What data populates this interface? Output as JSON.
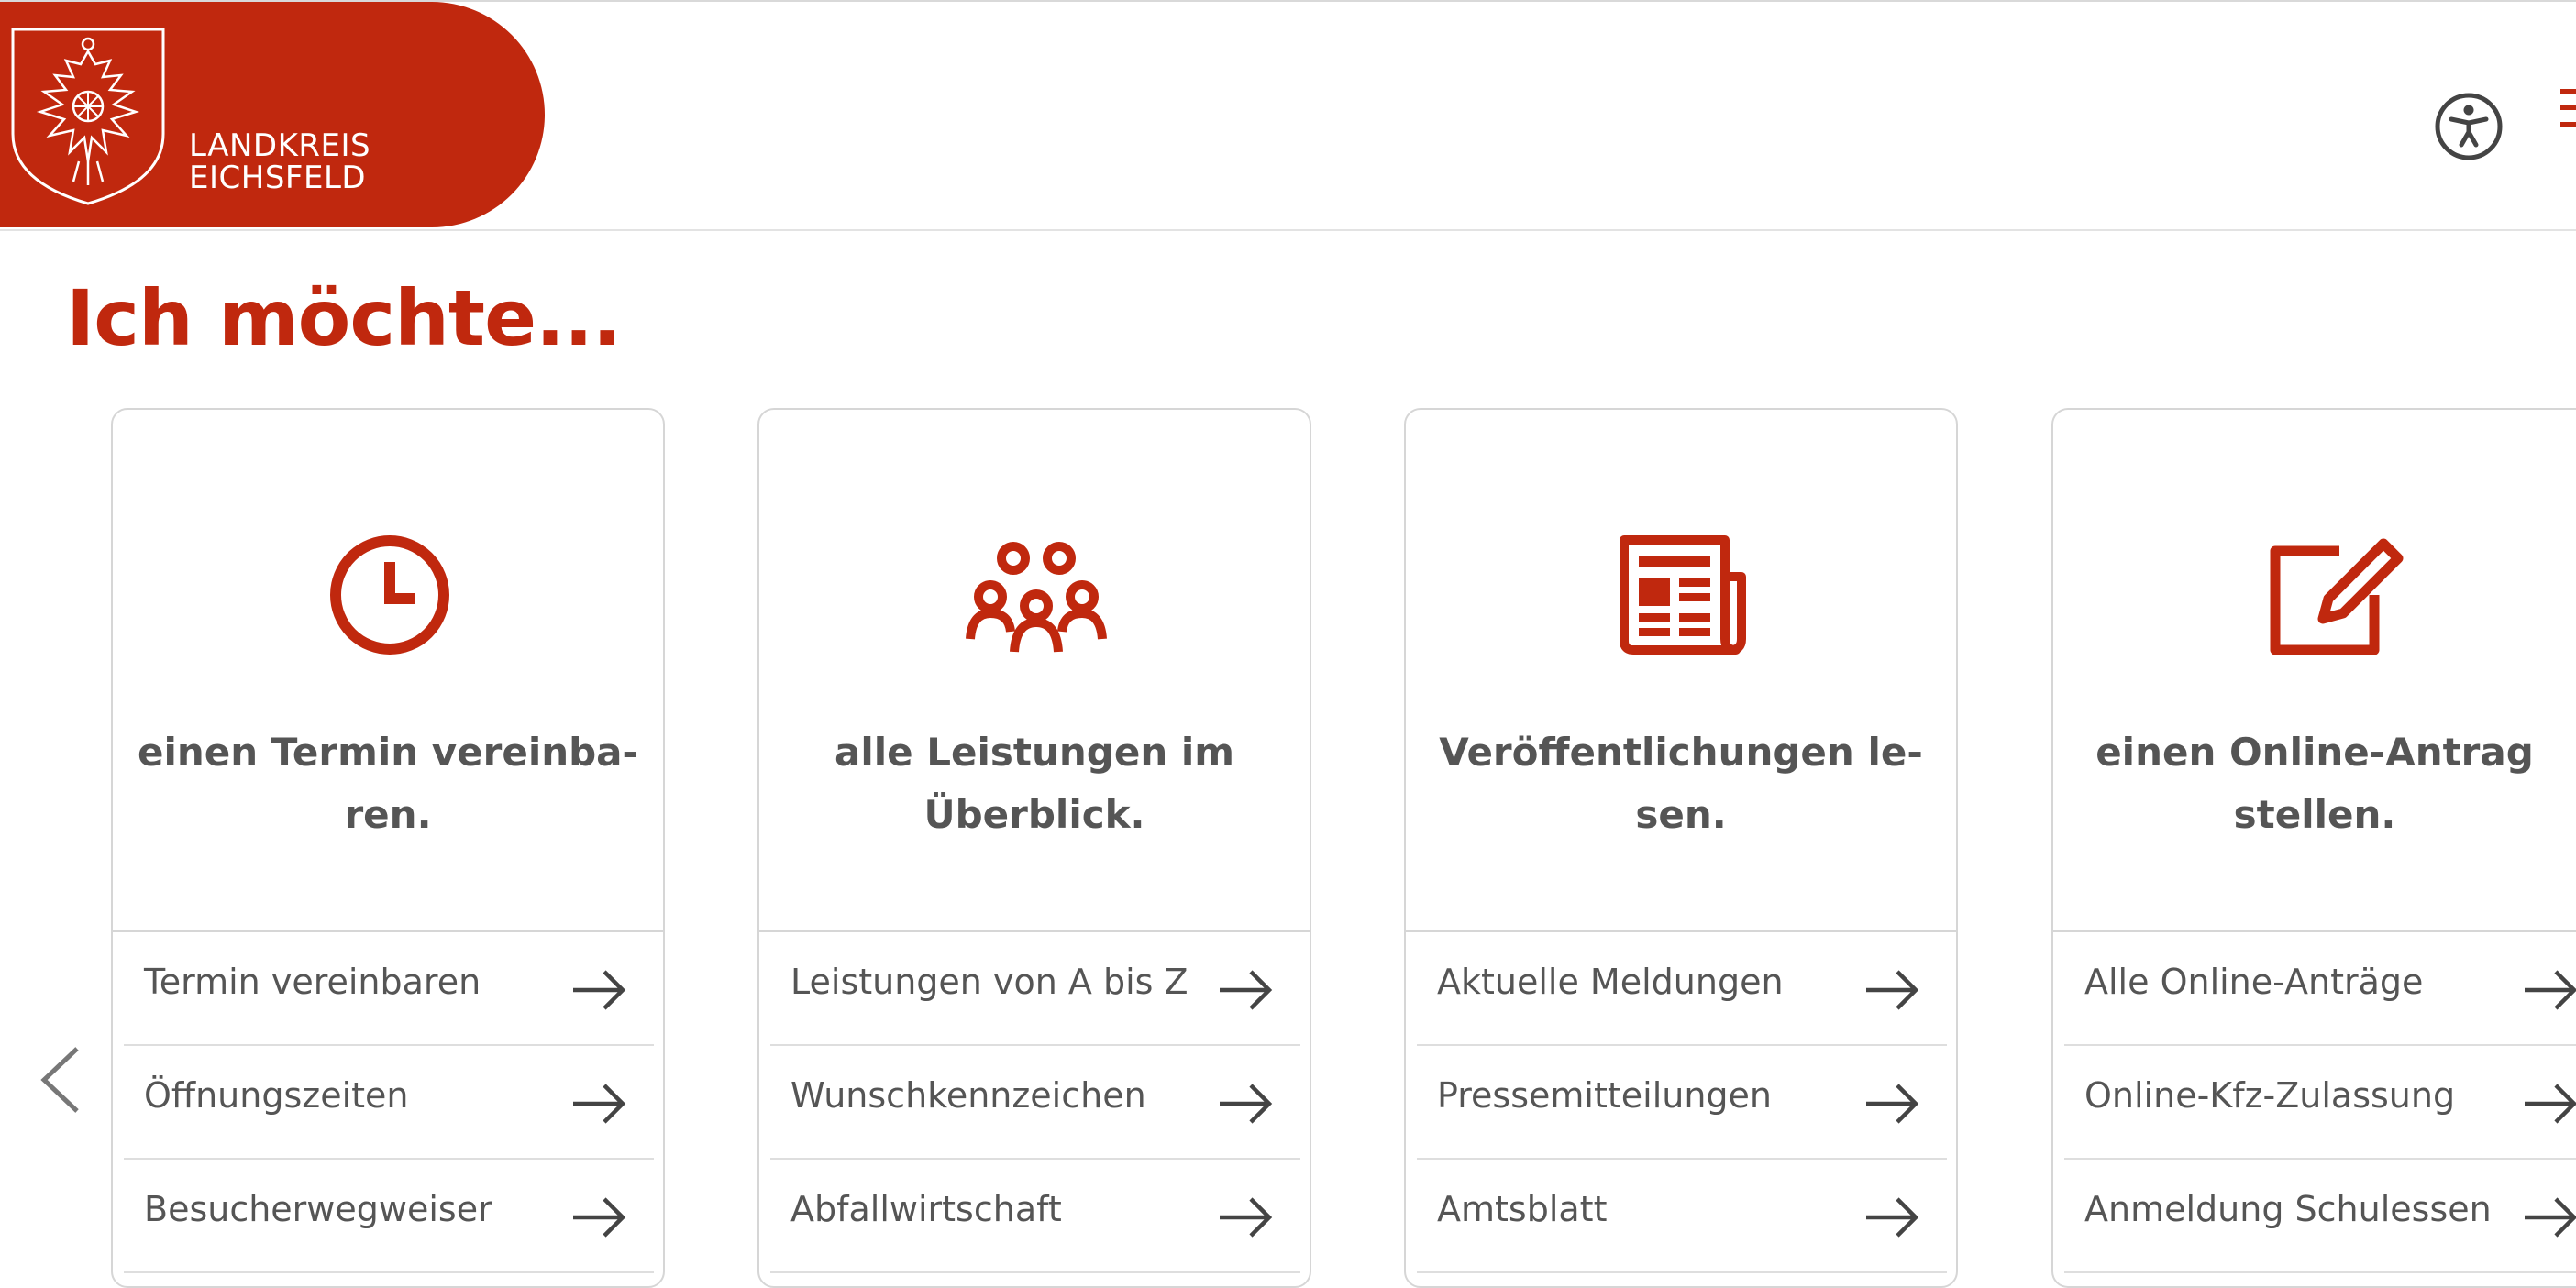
{
  "header": {
    "logo_line1": "LANDKREIS",
    "logo_line2": "EICHSFELD",
    "brand_color": "#c0280e",
    "accessibility_icon": "accessibility-icon",
    "menu_icon": "hamburger-menu-icon"
  },
  "main": {
    "title": "Ich möchte...",
    "cards": [
      {
        "icon": "clock-icon",
        "title_line1": "einen Termin vereinba-",
        "title_line2": "ren.",
        "links": [
          "Termin vereinbaren",
          "Öffnungszeiten",
          "Besucherwegweiser"
        ]
      },
      {
        "icon": "group-icon",
        "title_line1": "alle Leistungen im",
        "title_line2": "Überblick.",
        "links": [
          "Leistungen von A bis Z",
          "Wunschkennzeichen",
          "Abfallwirtschaft"
        ]
      },
      {
        "icon": "newspaper-icon",
        "title_line1": "Veröffentlichungen le-",
        "title_line2": "sen.",
        "links": [
          "Aktuelle Meldungen",
          "Pressemitteilungen",
          "Amtsblatt"
        ]
      },
      {
        "icon": "edit-icon",
        "title_line1": "einen Online-Antrag",
        "title_line2": "stellen.",
        "links": [
          "Alle Online-Anträge",
          "Online-Kfz-Zulassung",
          "Anmeldung Schulessen"
        ]
      }
    ],
    "prev_icon": "chevron-left-icon",
    "link_arrow_icon": "arrow-right-icon"
  }
}
